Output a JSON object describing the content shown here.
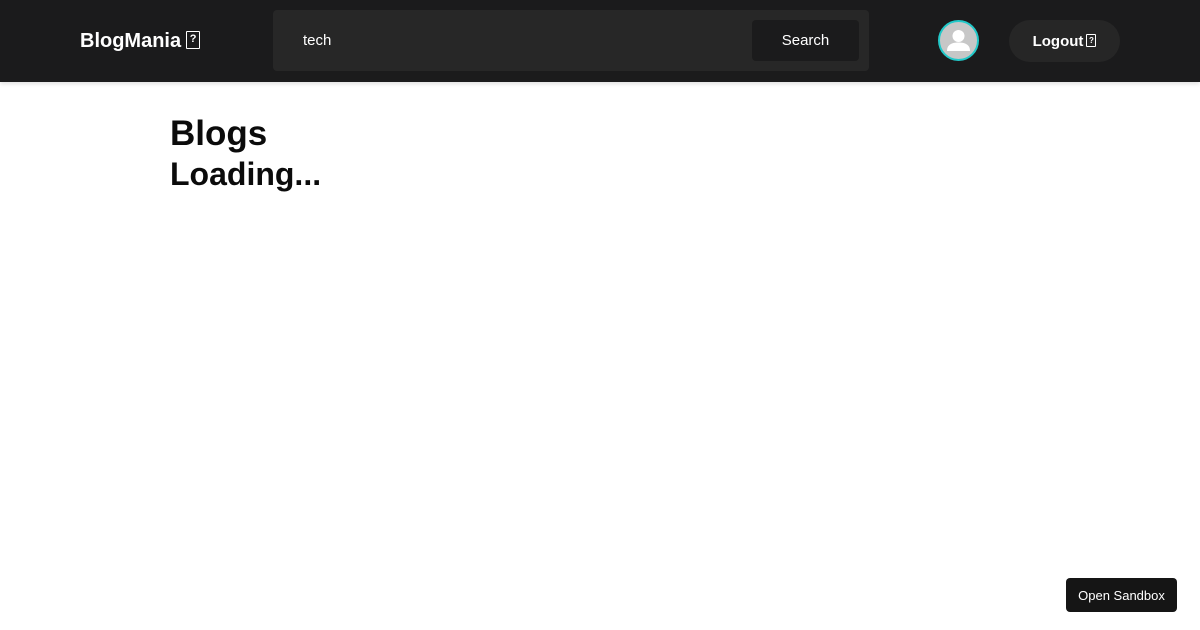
{
  "navbar": {
    "brand": "BlogMania",
    "brand_icon": "missing-glyph-icon",
    "search": {
      "value": "tech",
      "placeholder": "",
      "button_label": "Search"
    },
    "avatar_icon": "user-avatar-icon",
    "logout_label": "Logout",
    "logout_icon": "missing-glyph-icon",
    "colors": {
      "navbar_bg": "#1b1b1c",
      "search_bg": "#272727",
      "avatar_ring": "#22c9c9",
      "avatar_bg": "#c7c7c7"
    }
  },
  "main": {
    "title": "Blogs",
    "status": "Loading..."
  },
  "sandbox": {
    "label": "Open Sandbox"
  }
}
